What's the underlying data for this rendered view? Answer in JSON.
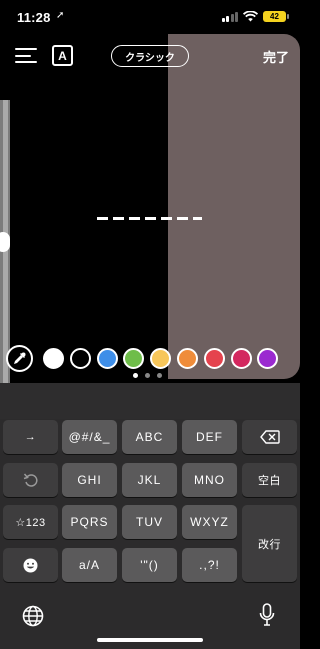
{
  "status_bar": {
    "time": "11:28",
    "location_glyph": "➚",
    "battery": "42"
  },
  "toolbar": {
    "text_style_letter": "A",
    "style_label": "クラシック",
    "done_label": "完了"
  },
  "colors": {
    "swatches": [
      "#ffffff",
      "#000000",
      "#3e8ee8",
      "#6fbd4a",
      "#f7c65a",
      "#ef8c3a",
      "#e5434e",
      "#d3285f",
      "#9b2ad0"
    ],
    "photo_tint": "#6e6060"
  },
  "keyboard": {
    "row1": [
      "→",
      "@#/&_",
      "ABC",
      "DEF",
      "⌫"
    ],
    "row2": [
      "↺",
      "GHI",
      "JKL",
      "MNO",
      "空白"
    ],
    "row3": [
      "☆123",
      "PQRS",
      "TUV",
      "WXYZ"
    ],
    "row4": [
      "☻",
      "a/A",
      "'\"()",
      ".,?!"
    ],
    "return_label": "改行"
  }
}
